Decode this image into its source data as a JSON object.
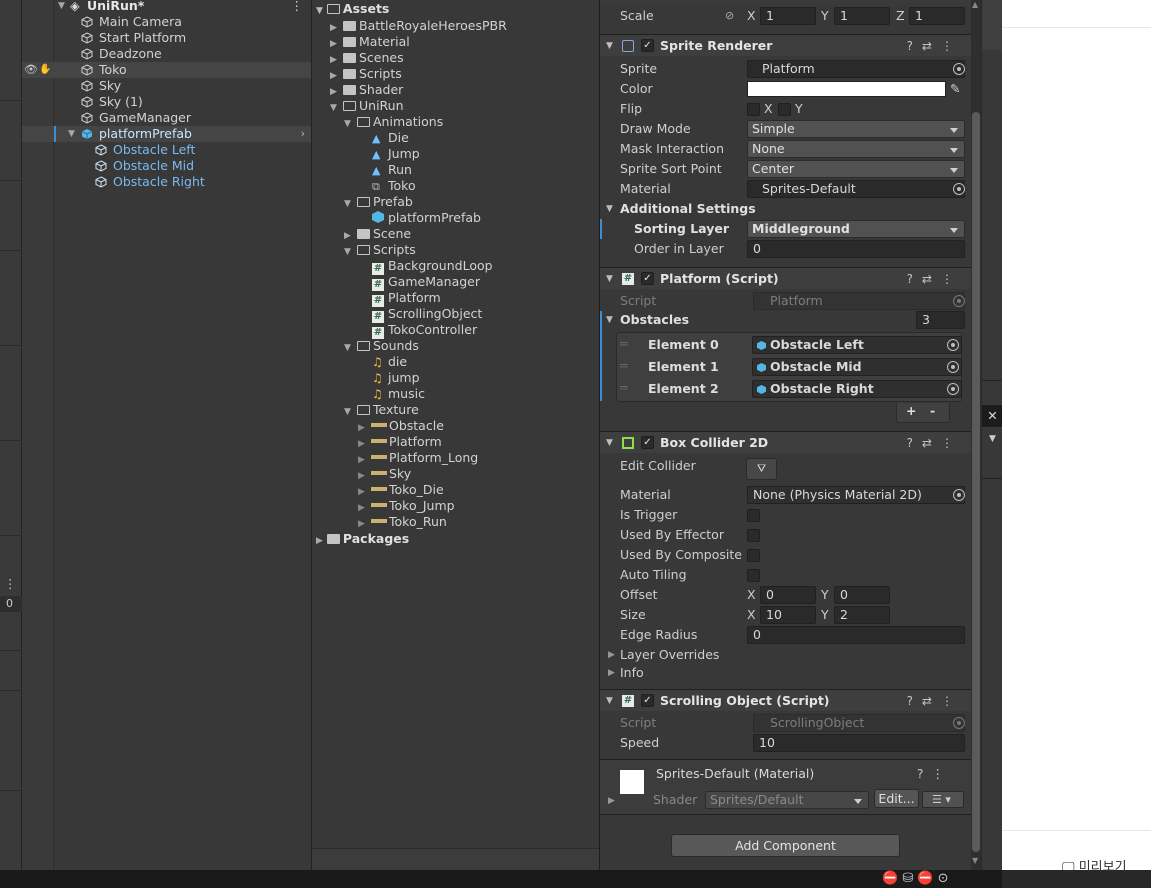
{
  "hierarchy": {
    "scene": "UniRun*",
    "items": [
      "Main Camera",
      "Start Platform",
      "Deadzone",
      "Toko",
      "Sky",
      "Sky (1)",
      "GameManager",
      "platformPrefab",
      "Obstacle Left",
      "Obstacle Mid",
      "Obstacle Right"
    ]
  },
  "left_strip": {
    "count": "0"
  },
  "project": {
    "root": "Assets",
    "items": [
      "BattleRoyaleHeroesPBR",
      "Material",
      "Scenes",
      "Scripts",
      "Shader",
      "UniRun",
      "Animations",
      "Die",
      "Jump",
      "Run",
      "Toko",
      "Prefab",
      "platformPrefab",
      "Scene",
      "Scripts",
      "BackgroundLoop",
      "GameManager",
      "Platform",
      "ScrollingObject",
      "TokoController",
      "Sounds",
      "die",
      "jump",
      "music",
      "Texture",
      "Obstacle",
      "Platform",
      "Platform_Long",
      "Sky",
      "Toko_Die",
      "Toko_Jump",
      "Toko_Run"
    ],
    "packages": "Packages"
  },
  "inspector": {
    "scale": {
      "label": "Scale",
      "x": "1",
      "y": "1",
      "z": "1",
      "xl": "X",
      "yl": "Y",
      "zl": "Z"
    },
    "sprite_renderer": {
      "title": "Sprite Renderer",
      "sprite_label": "Sprite",
      "sprite": "Platform",
      "color_label": "Color",
      "flip_label": "Flip",
      "flip_x": "X",
      "flip_y": "Y",
      "draw_mode_label": "Draw Mode",
      "draw_mode": "Simple",
      "mask_label": "Mask Interaction",
      "mask": "None",
      "sort_point_label": "Sprite Sort Point",
      "sort_point": "Center",
      "material_label": "Material",
      "material": "Sprites-Default",
      "additional": "Additional Settings",
      "sorting_layer_label": "Sorting Layer",
      "sorting_layer": "Middleground",
      "order_label": "Order in Layer",
      "order": "0"
    },
    "platform_script": {
      "title": "Platform (Script)",
      "script_label": "Script",
      "script": "Platform",
      "obstacles_label": "Obstacles",
      "obstacles_count": "3",
      "elements": [
        {
          "label": "Element 0",
          "value": "Obstacle Left"
        },
        {
          "label": "Element 1",
          "value": "Obstacle Mid"
        },
        {
          "label": "Element 2",
          "value": "Obstacle Right"
        }
      ],
      "plus": "+",
      "minus": "-"
    },
    "box_collider": {
      "title": "Box Collider 2D",
      "edit_label": "Edit Collider",
      "material_label": "Material",
      "material": "None (Physics Material 2D)",
      "trigger_label": "Is Trigger",
      "effector_label": "Used By Effector",
      "composite_label": "Used By Composite",
      "tiling_label": "Auto Tiling",
      "offset_label": "Offset",
      "offset_x": "0",
      "offset_y": "0",
      "size_label": "Size",
      "size_x": "10",
      "size_y": "2",
      "edge_label": "Edge Radius",
      "edge": "0",
      "layer_overrides": "Layer Overrides",
      "info": "Info",
      "xl": "X",
      "yl": "Y"
    },
    "scrolling": {
      "title": "Scrolling Object (Script)",
      "script_label": "Script",
      "script": "ScrollingObject",
      "speed_label": "Speed",
      "speed": "10"
    },
    "material_block": {
      "title": "Sprites-Default (Material)",
      "shader_label": "Shader",
      "shader": "Sprites/Default",
      "edit": "Edit..."
    },
    "add_component": "Add Component"
  },
  "side_panel": {
    "preview": "미리보기"
  }
}
